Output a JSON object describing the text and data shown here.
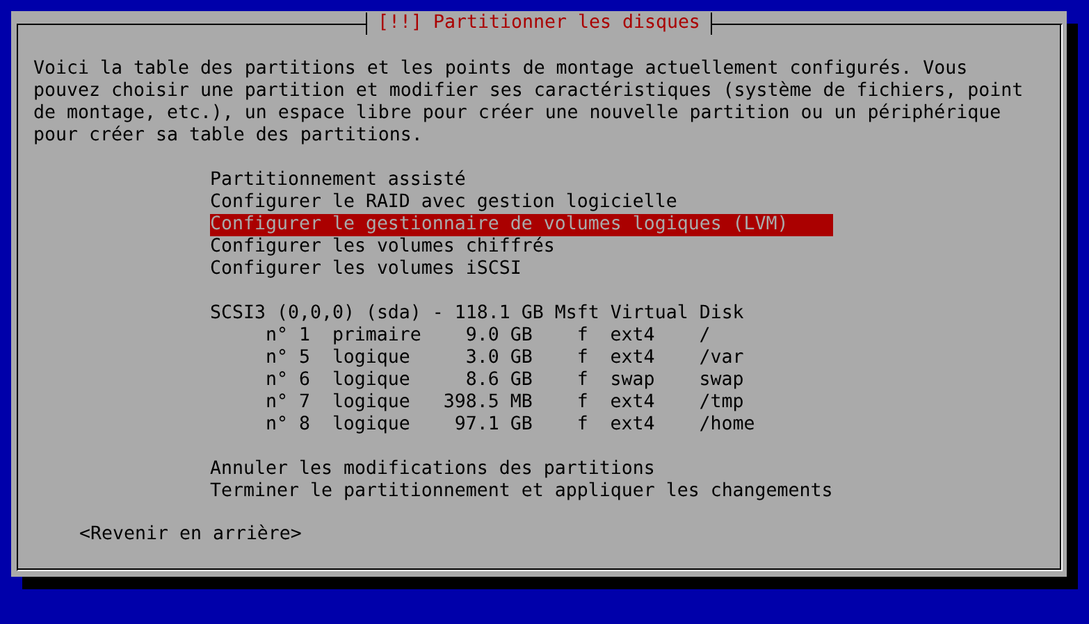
{
  "dialog": {
    "title": "[!!] Partitionner les disques",
    "description": "Voici la table des partitions et les points de montage actuellement configurés. Vous pouvez choisir une partition et modifier ses caractéristiques (système de fichiers, point de montage, etc.), un espace libre pour créer une nouvelle partition ou un périphérique pour créer sa table des partitions.",
    "actions": [
      {
        "label": "Partitionnement assisté",
        "selected": false
      },
      {
        "label": "Configurer le RAID avec gestion logicielle",
        "selected": false
      },
      {
        "label": "Configurer le gestionnaire de volumes logiques (LVM)",
        "selected": true
      },
      {
        "label": "Configurer les volumes chiffrés",
        "selected": false
      },
      {
        "label": "Configurer les volumes iSCSI",
        "selected": false
      }
    ],
    "disk": {
      "label": "SCSI3 (0,0,0) (sda) - 118.1 GB Msft Virtual Disk",
      "partitions": [
        {
          "number": "n° 1",
          "type": "primaire",
          "size": "9.0 GB",
          "flag": "f",
          "filesystem": "ext4",
          "mountpoint": "/"
        },
        {
          "number": "n° 5",
          "type": "logique",
          "size": "3.0 GB",
          "flag": "f",
          "filesystem": "ext4",
          "mountpoint": "/var"
        },
        {
          "number": "n° 6",
          "type": "logique",
          "size": "8.6 GB",
          "flag": "f",
          "filesystem": "swap",
          "mountpoint": "swap"
        },
        {
          "number": "n° 7",
          "type": "logique",
          "size": "398.5 MB",
          "flag": "f",
          "filesystem": "ext4",
          "mountpoint": "/tmp"
        },
        {
          "number": "n° 8",
          "type": "logique",
          "size": "97.1 GB",
          "flag": "f",
          "filesystem": "ext4",
          "mountpoint": "/home"
        }
      ]
    },
    "final_actions": [
      {
        "label": "Annuler les modifications des partitions",
        "selected": false
      },
      {
        "label": "Terminer le partitionnement et appliquer les changements",
        "selected": false
      }
    ],
    "back_button": "<Revenir en arrière>"
  }
}
